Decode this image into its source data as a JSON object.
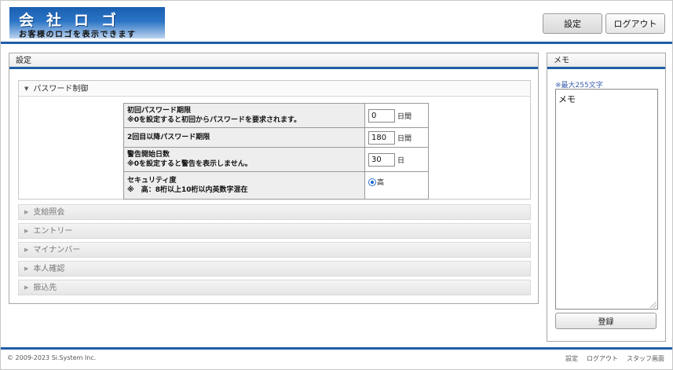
{
  "header": {
    "logo_main": "会社ロゴ",
    "logo_sub": "お客様のロゴを表示できます",
    "settings_label": "設定",
    "logout_label": "ログアウト"
  },
  "main": {
    "panel_title": "設定",
    "password_section": {
      "title": "パスワード制御",
      "rows": [
        {
          "label_line1": "初回パスワード期限",
          "label_line2": "※0を設定すると初回からパスワードを要求されます。",
          "value": "0",
          "unit": "日間"
        },
        {
          "label_line1": "2回目以降パスワード期限",
          "label_line2": "",
          "value": "180",
          "unit": "日間"
        },
        {
          "label_line1": "警告開始日数",
          "label_line2": "※0を設定すると警告を表示しません。",
          "value": "30",
          "unit": "日"
        },
        {
          "label_line1": "セキュリティ度",
          "label_line2": "※　高：8桁以上10桁以内英数字混在",
          "option": "高"
        }
      ]
    },
    "collapsed_sections": [
      {
        "label": "支給照会"
      },
      {
        "label": "エントリー"
      },
      {
        "label": "マイナンバー"
      },
      {
        "label": "本人確認"
      },
      {
        "label": "振込先"
      }
    ]
  },
  "memo": {
    "title": "メモ",
    "note": "※最大255文字",
    "text": "メモ",
    "register_label": "登録"
  },
  "footer": {
    "copyright": "© 2009-2023 Si.System Inc.",
    "links": [
      "設定",
      "ログアウト",
      "スタッフ画面"
    ]
  }
}
